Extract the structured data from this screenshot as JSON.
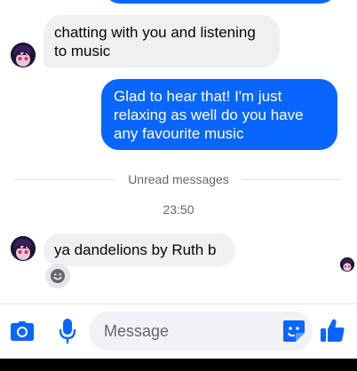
{
  "conversation": {
    "messages": [
      {
        "direction": "incoming",
        "text": "chatting with you and listening to music"
      },
      {
        "direction": "outgoing",
        "text": "Glad to hear that! I'm just relaxing as well do you have any favourite music"
      },
      {
        "direction": "incoming",
        "text": "ya dandelions by Ruth b"
      }
    ],
    "unread_label": "Unread messages",
    "timestamp": "23:50"
  },
  "composer": {
    "placeholder": "Message",
    "icons": [
      "camera-icon",
      "microphone-icon",
      "sticker-icon",
      "thumbs-up-icon"
    ]
  },
  "colors": {
    "accent": "#0866ff",
    "incoming_bubble": "#f0f0f0",
    "secondary_text": "#65676b"
  }
}
